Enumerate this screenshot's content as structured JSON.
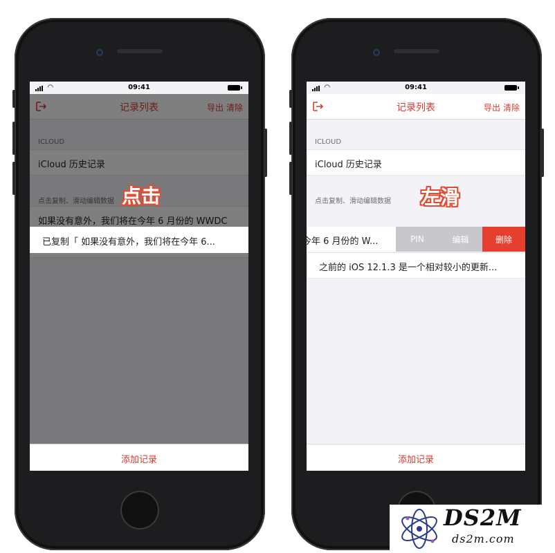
{
  "status_bar": {
    "time": "09:41"
  },
  "navbar": {
    "title": "记录列表",
    "export_label": "导出",
    "clear_label": "清除"
  },
  "sections": {
    "icloud_header": "ICLOUD",
    "icloud_row": "iCloud 历史记录",
    "records_header": "点击复制、滑动编辑数据"
  },
  "records": {
    "row_1_full": "如果没有意外，我们将在今年 6 月份的 WWDC",
    "row_1_swiped": "今年 6 月份的 W...",
    "row_2": "之前的 iOS 12.1.3 是一个相对较小的更新..."
  },
  "left_phone": {
    "annotation": "点击",
    "copied_toast": "已复制「 如果没有意外，我们将在今年 6..."
  },
  "right_phone": {
    "annotation": "左滑",
    "actions": {
      "pin": "PIN",
      "edit": "编辑",
      "delete": "删除"
    }
  },
  "footer": {
    "add_label": "添加记录"
  },
  "watermark": {
    "brand": "DS2M",
    "domain": "ds2m.com"
  },
  "colors": {
    "accent": "#d83a2f",
    "delete": "#e5402f",
    "action_gray": "#c7c7cc",
    "annotation_outline": "#e44b32"
  },
  "icons": {
    "back": "exit-icon",
    "signal": "signal-icon",
    "wifi": "wifi-icon",
    "battery": "battery-icon"
  }
}
